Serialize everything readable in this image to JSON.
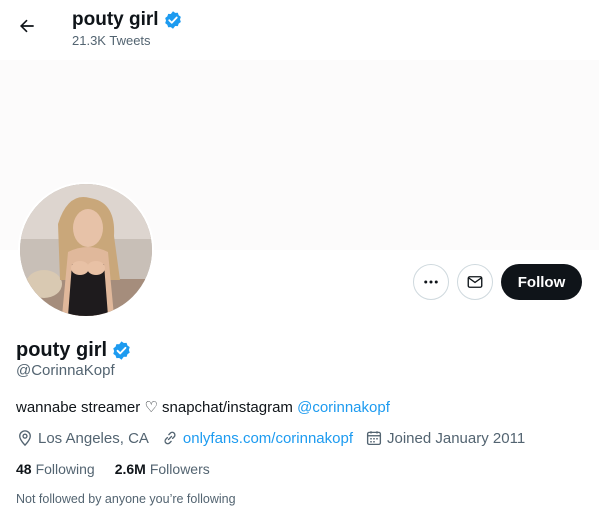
{
  "header": {
    "title": "pouty girl",
    "tweets_count": "21.3K Tweets"
  },
  "profile": {
    "name": "pouty girl",
    "handle": "@CorinnaKopf",
    "bio_text": "wannabe streamer ♡ snapchat/instagram ",
    "bio_mention": "@corinnakopf",
    "location": "Los Angeles, CA",
    "website": "onlyfans.com/corinnakopf",
    "joined": "Joined January 2011",
    "following_count": "48",
    "following_label": "Following",
    "followers_count": "2.6M",
    "followers_label": "Followers",
    "followed_by": "Not followed by anyone you’re following"
  },
  "actions": {
    "follow_label": "Follow"
  },
  "colors": {
    "accent": "#1d9bf0",
    "text_primary": "#0f1419",
    "text_secondary": "#536471",
    "follow_bg": "#0f1419"
  }
}
